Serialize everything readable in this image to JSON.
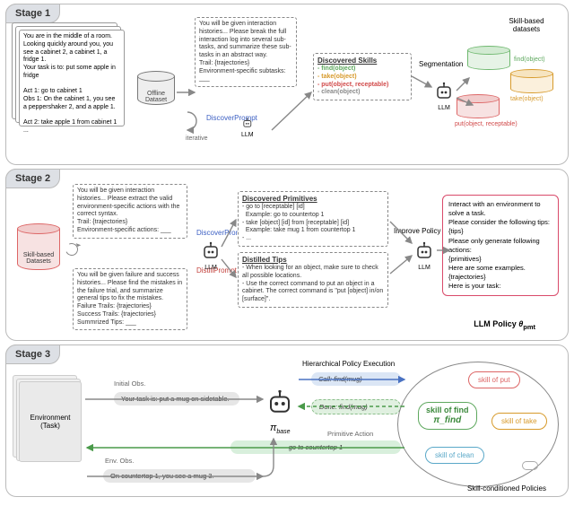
{
  "stages": {
    "s1": "Stage 1",
    "s2": "Stage 2",
    "s3": "Stage 3"
  },
  "s1": {
    "traj_card": "You are in the middle of a room. Looking quickly around you, you see a cabinet 2, a cabinet 1, a fridge 1.\nYour task is to: put some apple in fridge\n\nAct 1: go to cabinet 1\nObs 1: On the cabinet 1, you see a peppershaker 2, and a apple 1.\n\nAct 2: take apple 1 from cabinet 1\n...",
    "offline_db": "Offline\nDataset",
    "prompt": "You will be given interaction histories... Please break the full interaction log into several sub-tasks, and summarize these sub-tasks in an abstract way.\nTrail: {trajectories}\nEnvironment-specific subtasks: ___",
    "discover_label": "DiscoverPrompt",
    "iterative": "iterative",
    "llm": "LLM",
    "disc_title": "Discovered Skills",
    "skills": {
      "find": "- find(object)",
      "take": "- take(object)",
      "put": "- put(object, receptable)",
      "clean": "- clean(object)"
    },
    "segmentation": "Segmentation",
    "ds_title": "Skill-based\ndatasets",
    "ds": {
      "find": "find(object)",
      "take": "take(object)",
      "put": "put(object, receptable)"
    }
  },
  "s2": {
    "db": "Skill-based\nDatasets",
    "discover_prompt": "You will be given interaction histories... Please extract the valid environment-specific actions with the correct syntax.\nTrail: {trajectories}\nEnvironment-specific actions: ___",
    "discover_label": "DiscoverPrompt",
    "distill_label": "DistillPrompt",
    "distill_prompt": "You will be given failure and success histories... Please find the mistakes in the failure trial, and summarize general tips to fix the mistakes.\nFailure Trails: {trajectories}\nSuccess Trails: {trajectories}\nSummrized Tips: ___",
    "prim_title": "Discovered Primitives",
    "prim_body": "- go to [receptable] [id]\n  Example: go to countertop 1\n- take [object] [id] from [receptable] [id]\n  Example: take mug 1 from countertop 1\n- ...",
    "tips_title": "Distilled Tips",
    "tips_body": "- When looking for an object, make sure to check all possible locations.\n- Use the correct command to put an object in a cabinet. The correct command is \"put [object] in/on [surface]\".",
    "improve": "Improve Policy",
    "policy_box": "Interact with an environment to solve a task.\nPlease consider the following tips:\n{tips}\nPlease only generate following actions:\n{primitives}\nHere are some examples.\n{trajectories}\nHere is your task:",
    "policy_label_a": "LLM Policy ",
    "policy_label_b": "θ",
    "policy_label_c": "pmt"
  },
  "s3": {
    "env": "Environment (Task)",
    "hpe": "Hierarchical Policy Execution",
    "init_obs_lbl": "Initial Obs.",
    "init_obs": "Your task is: put a mug on sidetable.",
    "env_obs_lbl": "Env. Obs.",
    "env_obs": "On countertop 1, you see a mug 3.",
    "call": "Call: find(mug)",
    "done": "Done: find(mug)",
    "prim_lbl": "Primitive Action",
    "prim": "go to countertop 1",
    "pi_base": "π_base",
    "ellipse_caption": "Skill-conditioned Policies",
    "pills": {
      "put": "skill of put",
      "find_a": "skill of find",
      "find_b": "π_find",
      "take": "skill of take",
      "clean": "skill of clean"
    }
  }
}
